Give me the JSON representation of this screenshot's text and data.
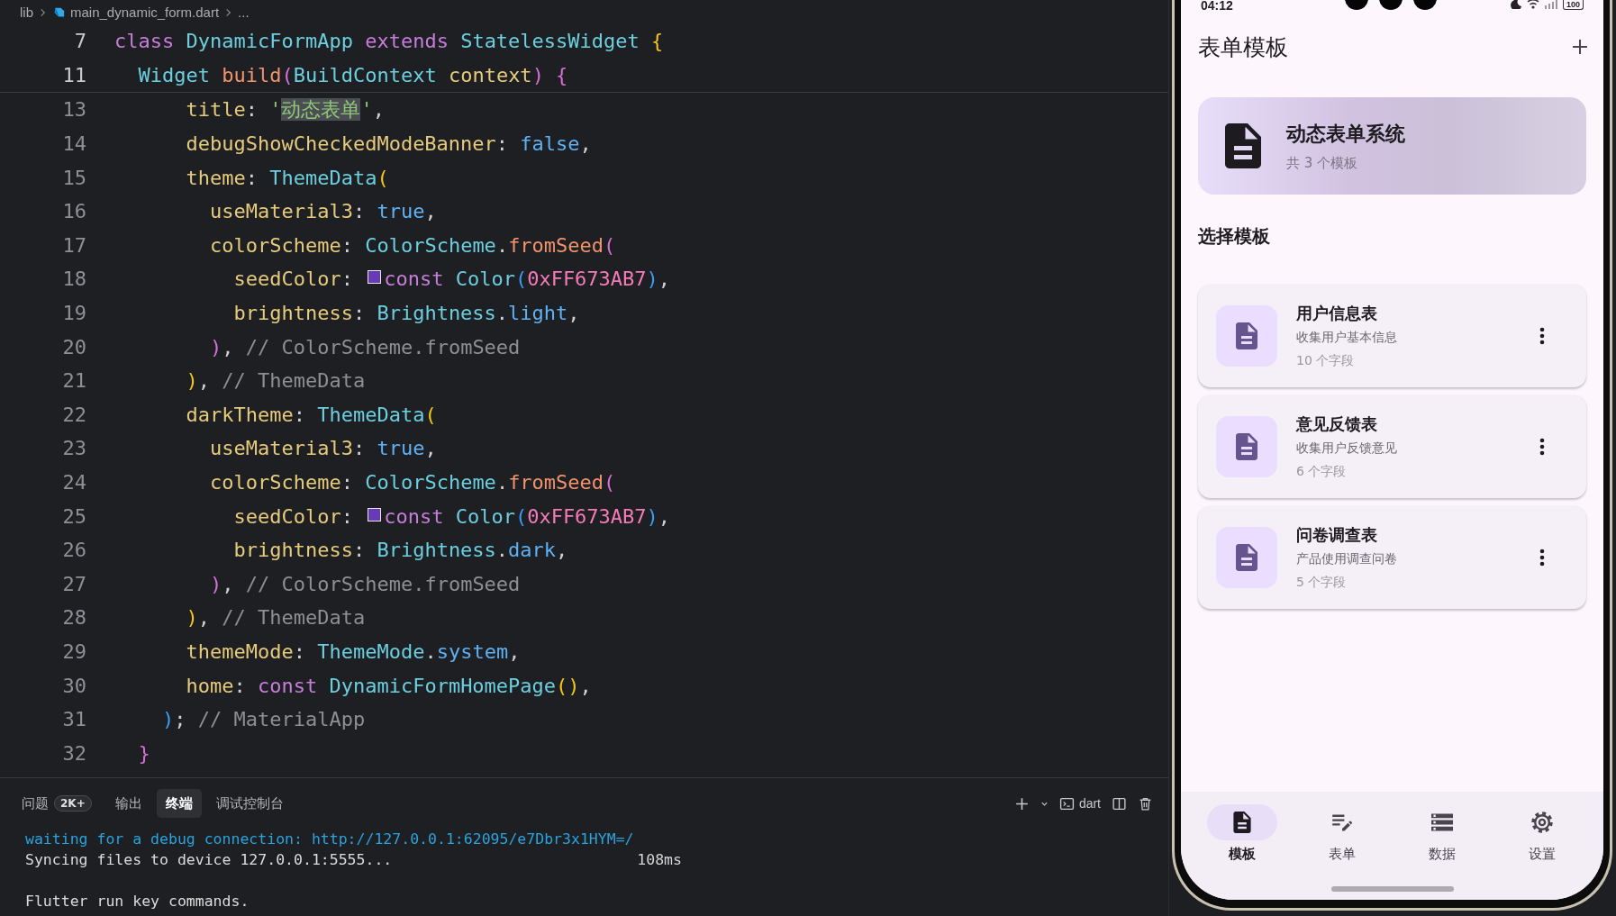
{
  "editor": {
    "breadcrumbs": [
      {
        "label": "lib",
        "kind": "folder"
      },
      {
        "label": "main_dynamic_form.dart",
        "kind": "file"
      },
      {
        "label": "...",
        "kind": "more"
      }
    ],
    "sticky_lines": [
      {
        "number": "7",
        "tokens": [
          {
            "text": "class",
            "kind": "keyword"
          },
          {
            "text": " DynamicFormApp",
            "kind": "type"
          },
          {
            "text": " extends",
            "kind": "keyword"
          },
          {
            "text": " StatelessWidget",
            "kind": "type"
          },
          {
            "text": " {",
            "kind": "bracket1"
          }
        ]
      },
      {
        "number": "11",
        "tokens": [
          {
            "text": "  Widget",
            "kind": "type"
          },
          {
            "text": " build",
            "kind": "function"
          },
          {
            "text": "(",
            "kind": "bracket2"
          },
          {
            "text": "BuildContext",
            "kind": "type"
          },
          {
            "text": " context",
            "kind": "property"
          },
          {
            "text": ")",
            "kind": "bracket2"
          },
          {
            "text": " {",
            "kind": "bracket2"
          }
        ]
      }
    ],
    "lines": [
      {
        "number": "13",
        "tokens": [
          {
            "text": "      title",
            "kind": "property"
          },
          {
            "text": ": ",
            "kind": "plain"
          },
          {
            "text": "'",
            "kind": "string"
          },
          {
            "text": "动态表单",
            "kind": "string",
            "highlighted": true
          },
          {
            "text": "'",
            "kind": "string"
          },
          {
            "text": ",",
            "kind": "plain"
          }
        ]
      },
      {
        "number": "14",
        "tokens": [
          {
            "text": "      debugShowCheckedModeBanner",
            "kind": "property"
          },
          {
            "text": ": ",
            "kind": "plain"
          },
          {
            "text": "false",
            "kind": "literal"
          },
          {
            "text": ",",
            "kind": "plain"
          }
        ]
      },
      {
        "number": "15",
        "tokens": [
          {
            "text": "      theme",
            "kind": "property"
          },
          {
            "text": ": ",
            "kind": "plain"
          },
          {
            "text": "ThemeData",
            "kind": "type"
          },
          {
            "text": "(",
            "kind": "bracket1"
          }
        ]
      },
      {
        "number": "16",
        "tokens": [
          {
            "text": "        useMaterial3",
            "kind": "property"
          },
          {
            "text": ": ",
            "kind": "plain"
          },
          {
            "text": "true",
            "kind": "literal"
          },
          {
            "text": ",",
            "kind": "plain"
          }
        ]
      },
      {
        "number": "17",
        "tokens": [
          {
            "text": "        colorScheme",
            "kind": "property"
          },
          {
            "text": ": ",
            "kind": "plain"
          },
          {
            "text": "ColorScheme",
            "kind": "type"
          },
          {
            "text": ".",
            "kind": "plain"
          },
          {
            "text": "fromSeed",
            "kind": "function"
          },
          {
            "text": "(",
            "kind": "bracket2"
          }
        ]
      },
      {
        "number": "18",
        "tokens": [
          {
            "text": "          seedColor",
            "kind": "property"
          },
          {
            "text": ": ",
            "kind": "plain"
          },
          {
            "kind": "swatch",
            "color": "#673ab7"
          },
          {
            "text": "const",
            "kind": "keyword"
          },
          {
            "text": " Color",
            "kind": "type"
          },
          {
            "text": "(",
            "kind": "bracket3"
          },
          {
            "text": "0xFF673AB7",
            "kind": "number"
          },
          {
            "text": ")",
            "kind": "bracket3"
          },
          {
            "text": ",",
            "kind": "plain"
          }
        ]
      },
      {
        "number": "19",
        "tokens": [
          {
            "text": "          brightness",
            "kind": "property"
          },
          {
            "text": ": ",
            "kind": "plain"
          },
          {
            "text": "Brightness",
            "kind": "type"
          },
          {
            "text": ".",
            "kind": "plain"
          },
          {
            "text": "light",
            "kind": "literal"
          },
          {
            "text": ",",
            "kind": "plain"
          }
        ]
      },
      {
        "number": "20",
        "tokens": [
          {
            "text": "        )",
            "kind": "bracket2"
          },
          {
            "text": ", ",
            "kind": "plain"
          },
          {
            "text": "// ColorScheme.fromSeed",
            "kind": "comment"
          }
        ]
      },
      {
        "number": "21",
        "tokens": [
          {
            "text": "      )",
            "kind": "bracket1"
          },
          {
            "text": ", ",
            "kind": "plain"
          },
          {
            "text": "// ThemeData",
            "kind": "comment"
          }
        ]
      },
      {
        "number": "22",
        "tokens": [
          {
            "text": "      darkTheme",
            "kind": "property"
          },
          {
            "text": ": ",
            "kind": "plain"
          },
          {
            "text": "ThemeData",
            "kind": "type"
          },
          {
            "text": "(",
            "kind": "bracket1"
          }
        ]
      },
      {
        "number": "23",
        "tokens": [
          {
            "text": "        useMaterial3",
            "kind": "property"
          },
          {
            "text": ": ",
            "kind": "plain"
          },
          {
            "text": "true",
            "kind": "literal"
          },
          {
            "text": ",",
            "kind": "plain"
          }
        ]
      },
      {
        "number": "24",
        "tokens": [
          {
            "text": "        colorScheme",
            "kind": "property"
          },
          {
            "text": ": ",
            "kind": "plain"
          },
          {
            "text": "ColorScheme",
            "kind": "type"
          },
          {
            "text": ".",
            "kind": "plain"
          },
          {
            "text": "fromSeed",
            "kind": "function"
          },
          {
            "text": "(",
            "kind": "bracket2"
          }
        ]
      },
      {
        "number": "25",
        "tokens": [
          {
            "text": "          seedColor",
            "kind": "property"
          },
          {
            "text": ": ",
            "kind": "plain"
          },
          {
            "kind": "swatch",
            "color": "#673ab7"
          },
          {
            "text": "const",
            "kind": "keyword"
          },
          {
            "text": " Color",
            "kind": "type"
          },
          {
            "text": "(",
            "kind": "bracket3"
          },
          {
            "text": "0xFF673AB7",
            "kind": "number"
          },
          {
            "text": ")",
            "kind": "bracket3"
          },
          {
            "text": ",",
            "kind": "plain"
          }
        ]
      },
      {
        "number": "26",
        "tokens": [
          {
            "text": "          brightness",
            "kind": "property"
          },
          {
            "text": ": ",
            "kind": "plain"
          },
          {
            "text": "Brightness",
            "kind": "type"
          },
          {
            "text": ".",
            "kind": "plain"
          },
          {
            "text": "dark",
            "kind": "literal"
          },
          {
            "text": ",",
            "kind": "plain"
          }
        ]
      },
      {
        "number": "27",
        "tokens": [
          {
            "text": "        )",
            "kind": "bracket2"
          },
          {
            "text": ", ",
            "kind": "plain"
          },
          {
            "text": "// ColorScheme.fromSeed",
            "kind": "comment"
          }
        ]
      },
      {
        "number": "28",
        "tokens": [
          {
            "text": "      )",
            "kind": "bracket1"
          },
          {
            "text": ", ",
            "kind": "plain"
          },
          {
            "text": "// ThemeData",
            "kind": "comment"
          }
        ]
      },
      {
        "number": "29",
        "tokens": [
          {
            "text": "      themeMode",
            "kind": "property"
          },
          {
            "text": ": ",
            "kind": "plain"
          },
          {
            "text": "ThemeMode",
            "kind": "type"
          },
          {
            "text": ".",
            "kind": "plain"
          },
          {
            "text": "system",
            "kind": "literal"
          },
          {
            "text": ",",
            "kind": "plain"
          }
        ]
      },
      {
        "number": "30",
        "tokens": [
          {
            "text": "      home",
            "kind": "property"
          },
          {
            "text": ": ",
            "kind": "plain"
          },
          {
            "text": "const",
            "kind": "keyword"
          },
          {
            "text": " DynamicFormHomePage",
            "kind": "type"
          },
          {
            "text": "()",
            "kind": "bracket1"
          },
          {
            "text": ",",
            "kind": "plain"
          }
        ]
      },
      {
        "number": "31",
        "tokens": [
          {
            "text": "    )",
            "kind": "bracket3"
          },
          {
            "text": "; ",
            "kind": "plain"
          },
          {
            "text": "// MaterialApp",
            "kind": "comment"
          }
        ]
      },
      {
        "number": "32",
        "tokens": [
          {
            "text": "  }",
            "kind": "bracket2"
          }
        ]
      }
    ]
  },
  "panel": {
    "tabs": [
      {
        "label": "问题",
        "badge": "2K+",
        "selected": false
      },
      {
        "label": "输出",
        "selected": false
      },
      {
        "label": "终端",
        "selected": true
      },
      {
        "label": "调试控制台",
        "selected": false
      }
    ],
    "shell_label": "dart",
    "terminal_lines": [
      {
        "text": "waiting for a debug connection: http://127.0.0.1:62095/e7Dbr3x1HYM=/",
        "kind": "info",
        "blank_before": false
      },
      {
        "text": "Syncing files to device 127.0.0.1:5555...",
        "duration": "108ms",
        "kind": "plain",
        "blank_before": false
      },
      {
        "text": "Flutter run key commands.",
        "kind": "plain",
        "blank_before": true
      }
    ]
  },
  "phone": {
    "status_bar": {
      "time": "04:12",
      "battery": "100"
    },
    "app_bar": {
      "title": "表单模板"
    },
    "banner": {
      "title": "动态表单系统",
      "subtitle": "共 3 个模板"
    },
    "section_title": "选择模板",
    "templates": [
      {
        "title": "用户信息表",
        "description": "收集用户基本信息",
        "field_count": "10 个字段"
      },
      {
        "title": "意见反馈表",
        "description": "收集用户反馈意见",
        "field_count": "6 个字段"
      },
      {
        "title": "问卷调查表",
        "description": "产品使用调查问卷",
        "field_count": "5 个字段"
      }
    ],
    "nav_items": [
      {
        "label": "模板",
        "selected": true
      },
      {
        "label": "表单",
        "selected": false
      },
      {
        "label": "数据",
        "selected": false
      },
      {
        "label": "设置",
        "selected": false
      }
    ]
  }
}
